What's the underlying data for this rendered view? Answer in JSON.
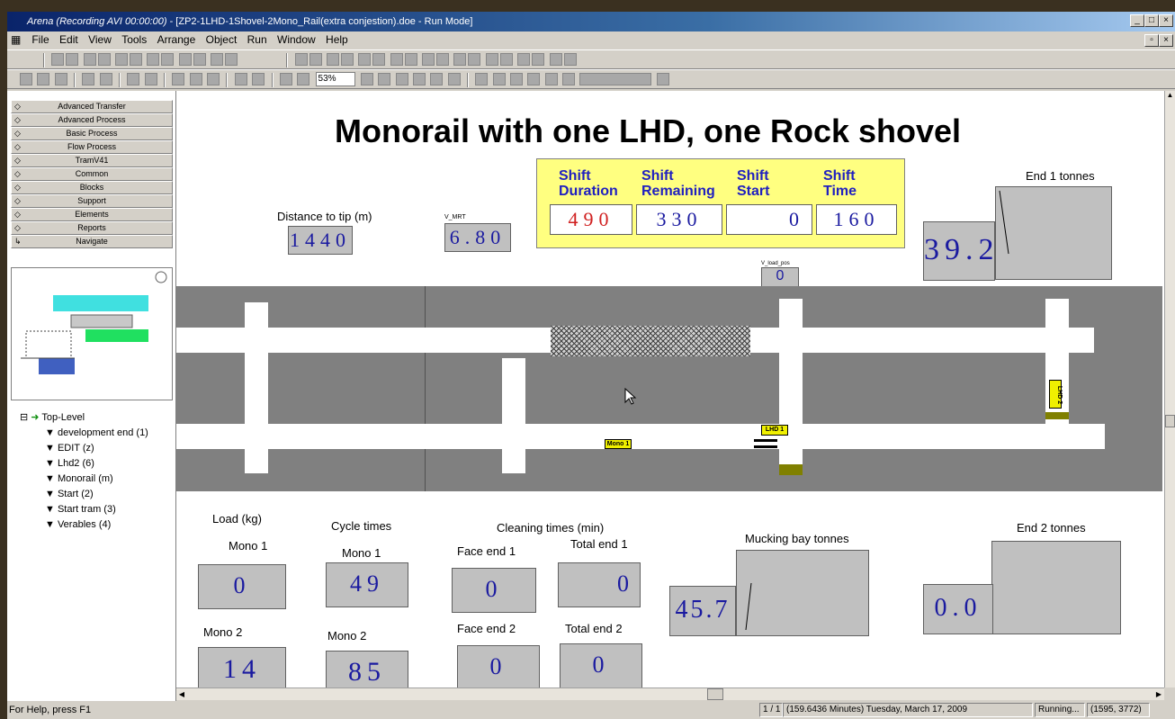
{
  "window": {
    "app_title": "Arena (Recording AVI 00:00:00)",
    "doc_title": " - [ZP2-1LHD-1Shovel-2Mono_Rail(extra conjestion).doe - Run Mode]"
  },
  "menu": [
    "File",
    "Edit",
    "View",
    "Tools",
    "Arrange",
    "Object",
    "Run",
    "Window",
    "Help"
  ],
  "toolbar": {
    "zoom": "53%"
  },
  "panels": [
    "Advanced Transfer",
    "Advanced Process",
    "Basic Process",
    "Flow Process",
    "TramV41",
    "Common",
    "Blocks",
    "Support",
    "Elements",
    "Reports",
    "Navigate"
  ],
  "tree": {
    "root": "Top-Level",
    "items": [
      "development end (1)",
      "EDIT (z)",
      "Lhd2 (6)",
      "Monorail (m)",
      "Start (2)",
      "Start tram (3)",
      "Verables (4)"
    ]
  },
  "canvas": {
    "title": "Monorail with one LHD, one Rock shovel",
    "distance_label": "Distance to tip (m)",
    "distance_value": "1440",
    "vmrt_label": "V_MRT",
    "vmrt_value": "6.80",
    "vload_label": "V_load_pos",
    "vload_value": "0",
    "shift": {
      "duration_label": "Shift Duration",
      "remaining_label": "Shift Remaining",
      "start_label": "Shift Start",
      "time_label": "Shift Time",
      "duration": "490",
      "remaining": "330",
      "start": "0",
      "time": "160"
    },
    "end1_label": "End 1 tonnes",
    "end1_value": "39.2",
    "vehicles": {
      "mono1": "Mono 1",
      "lhd1": "LHD 1",
      "lhd2": "LHD 2"
    },
    "load_label": "Load (kg)",
    "cycle_label": "Cycle times",
    "cleaning_label": "Cleaning times (min)",
    "mono1_label": "Mono 1",
    "mono2_label": "Mono 2",
    "load_mono1": "0",
    "load_mono2": "14",
    "cycle_mono1": "49",
    "cycle_mono2": "85",
    "face_end1_label": "Face end 1",
    "total_end1_label": "Total end 1",
    "face_end2_label": "Face end 2",
    "total_end2_label": "Total end 2",
    "face_end1": "0",
    "total_end1": "0",
    "face_end2": "0",
    "total_end2": "0",
    "mucking_label": "Mucking bay tonnes",
    "mucking_value": "45.7",
    "end2_label": "End 2 tonnes",
    "end2_value": "0.0"
  },
  "status": {
    "help": "For Help, press F1",
    "page": "1 / 1",
    "time": "(159.6436 Minutes) Tuesday, March 17, 2009",
    "state": "Running...",
    "coords": "(1595, 3772)"
  }
}
